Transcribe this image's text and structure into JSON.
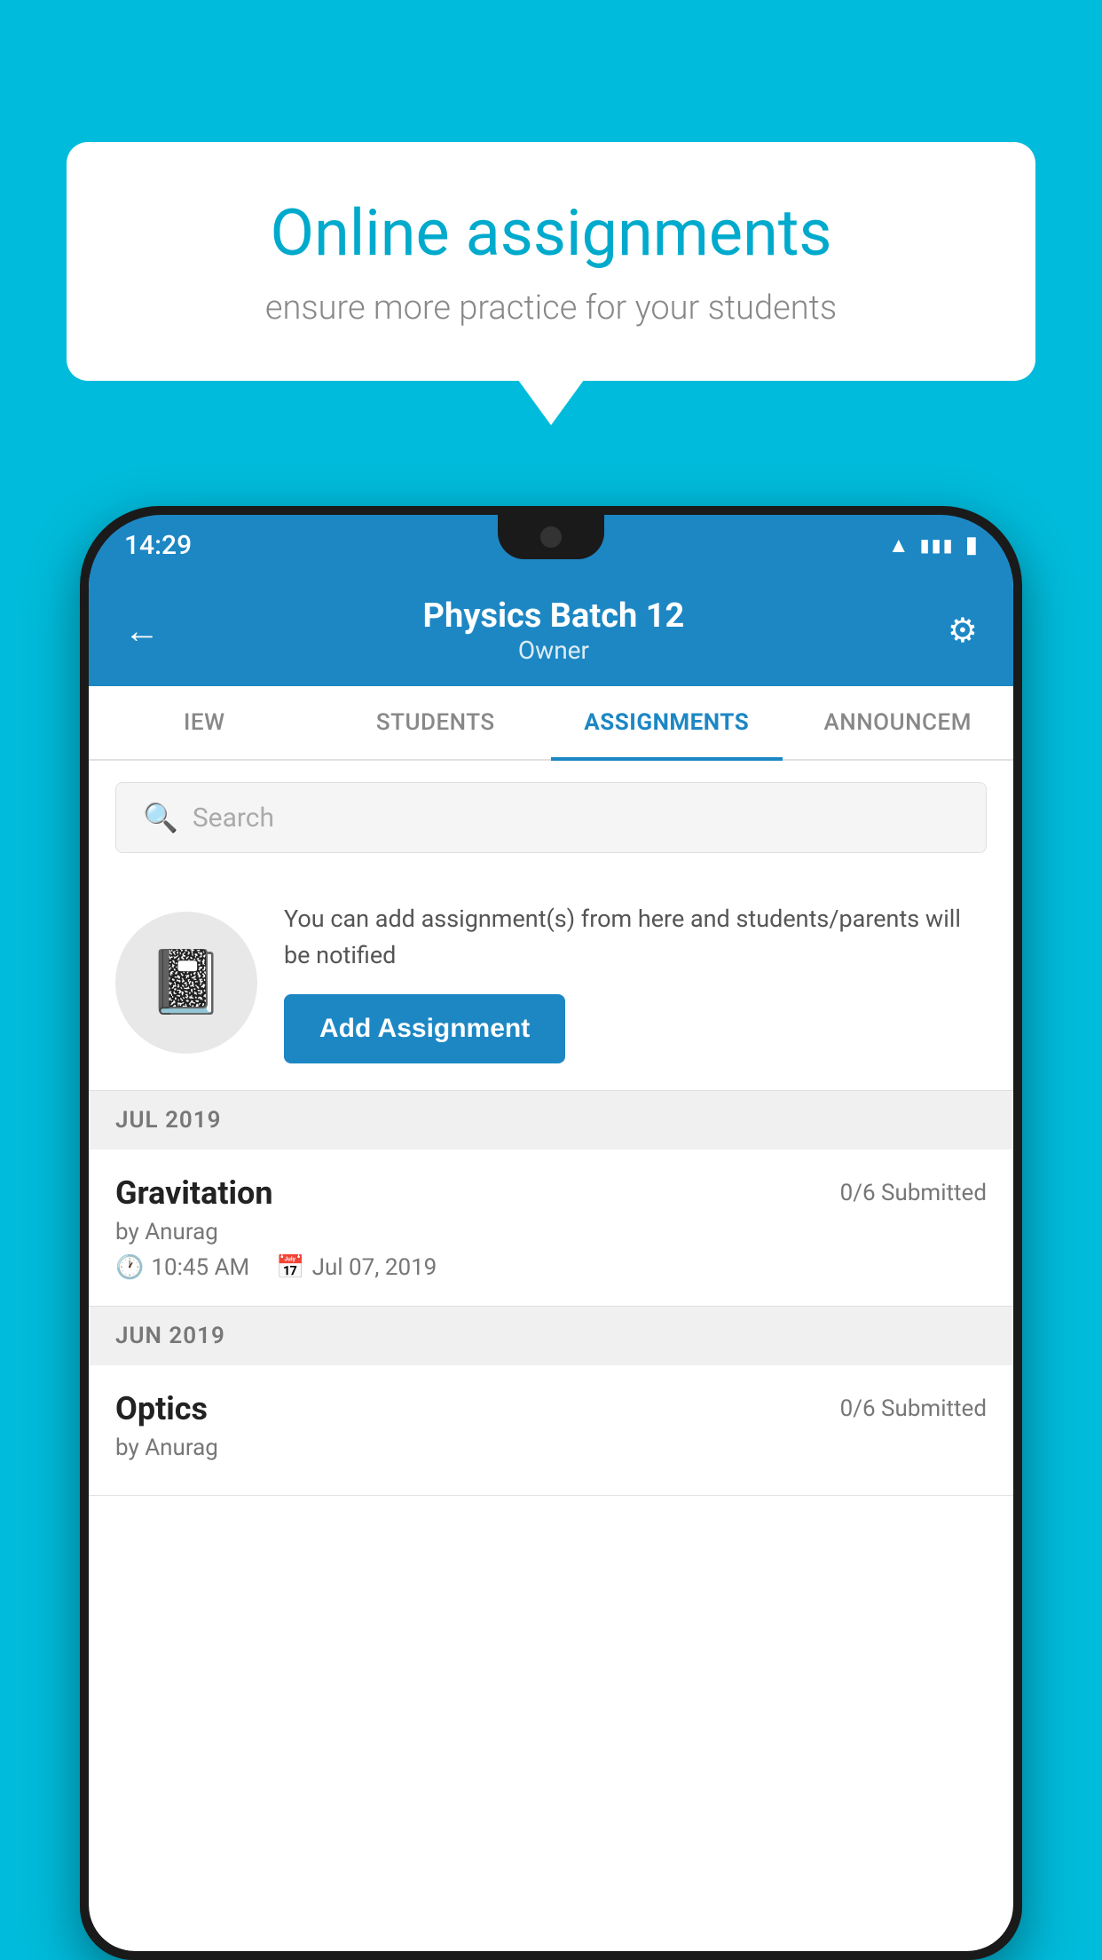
{
  "background": {
    "color": "#00BBDB"
  },
  "speech_bubble": {
    "title": "Online assignments",
    "subtitle": "ensure more practice for your students"
  },
  "phone": {
    "status_bar": {
      "time": "14:29"
    },
    "header": {
      "title": "Physics Batch 12",
      "subtitle": "Owner",
      "back_label": "←",
      "settings_label": "⚙"
    },
    "tabs": [
      {
        "label": "IEW",
        "active": false
      },
      {
        "label": "STUDENTS",
        "active": false
      },
      {
        "label": "ASSIGNMENTS",
        "active": true
      },
      {
        "label": "ANNOUNCEM",
        "active": false
      }
    ],
    "search": {
      "placeholder": "Search"
    },
    "promo": {
      "text": "You can add assignment(s) from here and students/parents will be notified",
      "button_label": "Add Assignment"
    },
    "sections": [
      {
        "header": "JUL 2019",
        "assignments": [
          {
            "name": "Gravitation",
            "submitted": "0/6 Submitted",
            "by": "by Anurag",
            "time": "10:45 AM",
            "date": "Jul 07, 2019"
          }
        ]
      },
      {
        "header": "JUN 2019",
        "assignments": [
          {
            "name": "Optics",
            "submitted": "0/6 Submitted",
            "by": "by Anurag",
            "time": "",
            "date": ""
          }
        ]
      }
    ]
  }
}
